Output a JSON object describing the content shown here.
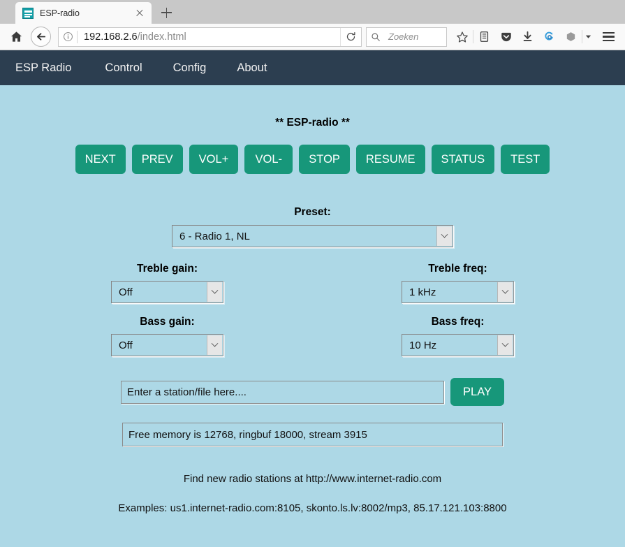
{
  "browser": {
    "tab": {
      "title": "ESP-radio",
      "favicon_name": "esp-radio-favicon"
    },
    "new_tab_label": "+",
    "url": "192.168.2.6",
    "url_path": "/index.html",
    "search_placeholder": "Zoeken",
    "icons": {
      "home": "home-icon",
      "back": "back-arrow-icon",
      "info": "info-icon",
      "reload": "reload-icon",
      "search": "search-icon",
      "bookmark": "star-icon",
      "library": "library-icon",
      "pocket": "pocket-icon",
      "downloads": "download-arrow-icon",
      "sync": "sync-icon",
      "shield": "hexagon-icon",
      "overflow": "chevron-down-icon",
      "menu": "hamburger-menu-icon"
    }
  },
  "site": {
    "nav": [
      {
        "label": "ESP Radio"
      },
      {
        "label": "Control"
      },
      {
        "label": "Config"
      },
      {
        "label": "About"
      }
    ],
    "title": "** ESP-radio **",
    "buttons": [
      {
        "label": "NEXT"
      },
      {
        "label": "PREV"
      },
      {
        "label": "VOL+"
      },
      {
        "label": "VOL-"
      },
      {
        "label": "STOP"
      },
      {
        "label": "RESUME"
      },
      {
        "label": "STATUS"
      },
      {
        "label": "TEST"
      }
    ],
    "preset": {
      "label": "Preset:",
      "value": "6 - Radio 1, NL"
    },
    "equalizer": [
      {
        "label": "Treble gain:",
        "value": "Off"
      },
      {
        "label": "Treble freq:",
        "value": "1 kHz"
      },
      {
        "label": "Bass gain:",
        "value": "Off"
      },
      {
        "label": "Bass freq:",
        "value": "10 Hz"
      }
    ],
    "station": {
      "placeholder": "Enter a station/file here....",
      "value": "",
      "play_label": "PLAY"
    },
    "status": "Free memory is 12768, ringbuf 18000, stream 3915",
    "footer": {
      "line1": "Find new radio stations at http://www.internet-radio.com",
      "line2": "Examples: us1.internet-radio.com:8105, skonto.ls.lv:8002/mp3, 85.17.121.103:8800"
    },
    "colors": {
      "background": "#add8e6",
      "navbar": "#2c3e50",
      "accent": "#17977a",
      "text": "#111111"
    }
  }
}
